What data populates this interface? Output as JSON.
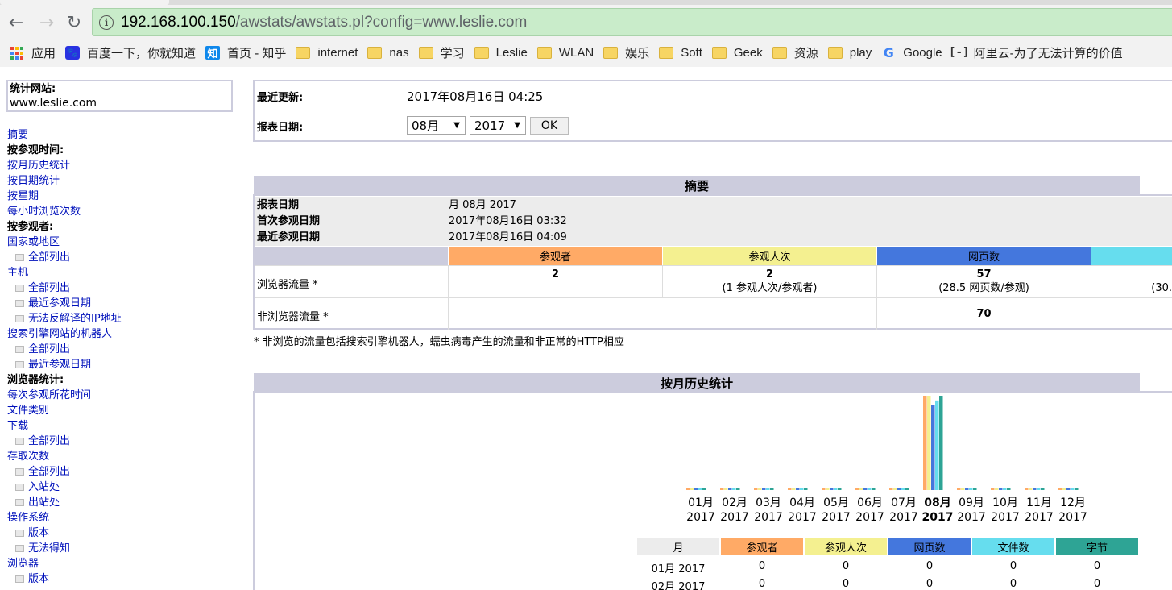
{
  "browser": {
    "url_host": "192.168.100.150",
    "url_path": "/awstats/awstats.pl?config=www.leslie.com",
    "bookmarks": [
      {
        "label": "应用",
        "icon": "apps-icon"
      },
      {
        "label": "百度一下，你就知道",
        "icon": "baidu-icon"
      },
      {
        "label": "首页 - 知乎",
        "icon": "zhihu-icon"
      },
      {
        "label": "internet",
        "icon": "folder-icon"
      },
      {
        "label": "nas",
        "icon": "folder-icon"
      },
      {
        "label": "学习",
        "icon": "folder-icon"
      },
      {
        "label": "Leslie",
        "icon": "folder-icon"
      },
      {
        "label": "WLAN",
        "icon": "folder-icon"
      },
      {
        "label": "娱乐",
        "icon": "folder-icon"
      },
      {
        "label": "Soft",
        "icon": "folder-icon"
      },
      {
        "label": "Geek",
        "icon": "folder-icon"
      },
      {
        "label": "资源",
        "icon": "folder-icon"
      },
      {
        "label": "play",
        "icon": "folder-icon"
      },
      {
        "label": "Google",
        "icon": "google-icon"
      },
      {
        "label": "阿里云-为了无法计算的价值",
        "icon": "aliyun-icon"
      }
    ]
  },
  "sidebar": {
    "site_label": "统计网站:",
    "site_value": "www.leslie.com",
    "menu": [
      {
        "text": "摘要",
        "type": "link"
      },
      {
        "text": "按参观时间:",
        "type": "head"
      },
      {
        "text": "按月历史统计",
        "type": "link"
      },
      {
        "text": "按日期统计",
        "type": "link"
      },
      {
        "text": "按星期",
        "type": "link"
      },
      {
        "text": "每小时浏览次数",
        "type": "link"
      },
      {
        "text": "按参观者:",
        "type": "head"
      },
      {
        "text": "国家或地区",
        "type": "link"
      },
      {
        "text": "全部列出",
        "type": "sub"
      },
      {
        "text": "主机",
        "type": "link"
      },
      {
        "text": "全部列出",
        "type": "sub"
      },
      {
        "text": "最近参观日期",
        "type": "sub"
      },
      {
        "text": "无法反解译的IP地址",
        "type": "sub"
      },
      {
        "text": "搜索引擎网站的机器人",
        "type": "link"
      },
      {
        "text": "全部列出",
        "type": "sub"
      },
      {
        "text": "最近参观日期",
        "type": "sub"
      },
      {
        "text": "浏览器统计:",
        "type": "head"
      },
      {
        "text": "每次参观所花时间",
        "type": "link"
      },
      {
        "text": "文件类别",
        "type": "link"
      },
      {
        "text": "下载",
        "type": "link"
      },
      {
        "text": "全部列出",
        "type": "sub"
      },
      {
        "text": "存取次数",
        "type": "link"
      },
      {
        "text": "全部列出",
        "type": "sub"
      },
      {
        "text": "入站处",
        "type": "sub"
      },
      {
        "text": "出站处",
        "type": "sub"
      },
      {
        "text": "操作系统",
        "type": "link"
      },
      {
        "text": "版本",
        "type": "sub"
      },
      {
        "text": "无法得知",
        "type": "sub"
      },
      {
        "text": "浏览器",
        "type": "link"
      },
      {
        "text": "版本",
        "type": "sub"
      }
    ]
  },
  "header": {
    "last_update_label": "最近更新:",
    "last_update_value": "2017年08月16日 04:25",
    "report_date_label": "报表日期:",
    "month_select": "08月",
    "year_select": "2017",
    "ok_label": "OK"
  },
  "summary": {
    "title": "摘要",
    "report_date_label": "报表日期",
    "report_date_value": "月 08月 2017",
    "first_visit_label": "首次参观日期",
    "first_visit_value": "2017年08月16日 03:32",
    "last_visit_label": "最近参观日期",
    "last_visit_value": "2017年08月16日 04:09",
    "col_visitors": "参观者",
    "col_visits": "参观人次",
    "col_pages": "网页数",
    "browser_traffic_label": "浏览器流量 *",
    "browser_visitors": "2",
    "browser_visits": "2",
    "browser_visits_sub": "(1 参观人次/参观者)",
    "browser_pages": "57",
    "browser_pages_sub": "(28.5 网页数/参观)",
    "browser_files_sub": "(30.",
    "nonbrowser_traffic_label": "非浏览器流量 *",
    "nonbrowser_pages": "70",
    "footnote": "* 非浏览的流量包括搜索引擎机器人，蠕虫病毒产生的流量和非正常的HTTP相应"
  },
  "monthly": {
    "title": "按月历史统计",
    "months": [
      "01月",
      "02月",
      "03月",
      "04月",
      "05月",
      "06月",
      "07月",
      "08月",
      "09月",
      "10月",
      "11月",
      "12月"
    ],
    "year": "2017",
    "current_month_index": 7,
    "table_headers": [
      "月",
      "参观者",
      "参观人次",
      "网页数",
      "文件数",
      "字节"
    ],
    "table_rows": [
      [
        "01月 2017",
        "0",
        "0",
        "0",
        "0",
        "0"
      ],
      [
        "02月 2017",
        "0",
        "0",
        "0",
        "0",
        "0"
      ]
    ]
  },
  "colors": {
    "visitors": "#ffaa66",
    "visits": "#f4f090",
    "pages": "#4477dd",
    "files": "#66ddee",
    "bytes": "#2ea495",
    "section_bg": "#ccccdd",
    "link": "#0011bb"
  },
  "chart_data": {
    "type": "bar",
    "categories": [
      "01月 2017",
      "02月 2017",
      "03月 2017",
      "04月 2017",
      "05月 2017",
      "06月 2017",
      "07月 2017",
      "08月 2017",
      "09月 2017",
      "10月 2017",
      "11月 2017",
      "12月 2017"
    ],
    "series": [
      {
        "name": "参观者",
        "values": [
          0,
          0,
          0,
          0,
          0,
          0,
          0,
          1.0,
          0,
          0,
          0,
          0
        ]
      },
      {
        "name": "参观人次",
        "values": [
          0,
          0,
          0,
          0,
          0,
          0,
          0,
          1.0,
          0,
          0,
          0,
          0
        ]
      },
      {
        "name": "网页数",
        "values": [
          0,
          0,
          0,
          0,
          0,
          0,
          0,
          0.9,
          0,
          0,
          0,
          0
        ]
      },
      {
        "name": "文件数",
        "values": [
          0,
          0,
          0,
          0,
          0,
          0,
          0,
          0.95,
          0,
          0,
          0,
          0
        ]
      },
      {
        "name": "字节",
        "values": [
          0,
          0,
          0,
          0,
          0,
          0,
          0,
          1.0,
          0,
          0,
          0,
          0
        ]
      }
    ],
    "title": "按月历史统计",
    "xlabel": "",
    "ylabel": "",
    "ylim": [
      0,
      1
    ]
  }
}
